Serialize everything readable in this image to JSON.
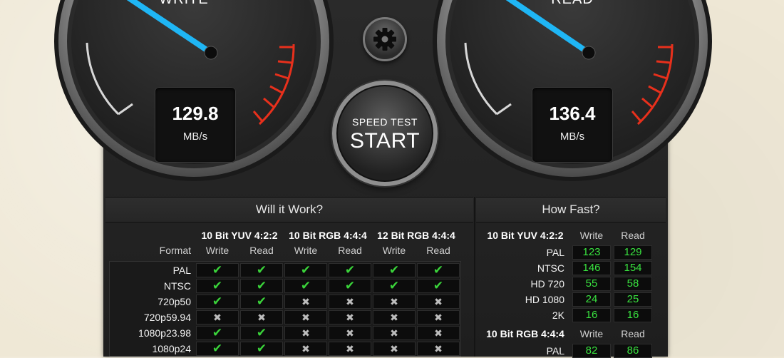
{
  "gauges": {
    "write": {
      "title": "WRITE",
      "value": "129.8",
      "unit": "MB/s"
    },
    "read": {
      "title": "READ",
      "value": "136.4",
      "unit": "MB/s"
    }
  },
  "start_button": {
    "sub": "SPEED TEST",
    "main": "START"
  },
  "settings_icon": "gear-icon",
  "will_it_work": {
    "title": "Will it Work?",
    "format_label": "Format",
    "groups": [
      "10 Bit YUV 4:2:2",
      "10 Bit RGB 4:4:4",
      "12 Bit RGB 4:4:4"
    ],
    "subcols": [
      "Write",
      "Read"
    ],
    "rows": [
      {
        "label": "PAL",
        "checks": [
          true,
          true,
          true,
          true,
          true,
          true
        ]
      },
      {
        "label": "NTSC",
        "checks": [
          true,
          true,
          true,
          true,
          true,
          true
        ]
      },
      {
        "label": "720p50",
        "checks": [
          true,
          true,
          false,
          false,
          false,
          false
        ]
      },
      {
        "label": "720p59.94",
        "checks": [
          false,
          false,
          false,
          false,
          false,
          false
        ]
      },
      {
        "label": "1080p23.98",
        "checks": [
          true,
          true,
          false,
          false,
          false,
          false
        ]
      },
      {
        "label": "1080p24",
        "checks": [
          true,
          true,
          false,
          false,
          false,
          false
        ]
      }
    ]
  },
  "how_fast": {
    "title": "How Fast?",
    "sections": [
      {
        "group": "10 Bit YUV 4:2:2",
        "subcols": [
          "Write",
          "Read"
        ],
        "rows": [
          {
            "label": "PAL",
            "write": "123",
            "read": "129"
          },
          {
            "label": "NTSC",
            "write": "146",
            "read": "154"
          },
          {
            "label": "HD 720",
            "write": "55",
            "read": "58"
          },
          {
            "label": "HD 1080",
            "write": "24",
            "read": "25"
          },
          {
            "label": "2K",
            "write": "16",
            "read": "16"
          }
        ]
      },
      {
        "group": "10 Bit RGB 4:4:4",
        "subcols": [
          "Write",
          "Read"
        ],
        "rows": [
          {
            "label": "PAL",
            "write": "82",
            "read": "86"
          }
        ]
      }
    ]
  },
  "colors": {
    "needle": "#1fb6f5",
    "redline": "#e8301c",
    "check": "#3ad33a",
    "speed_text": "#39e23f"
  }
}
